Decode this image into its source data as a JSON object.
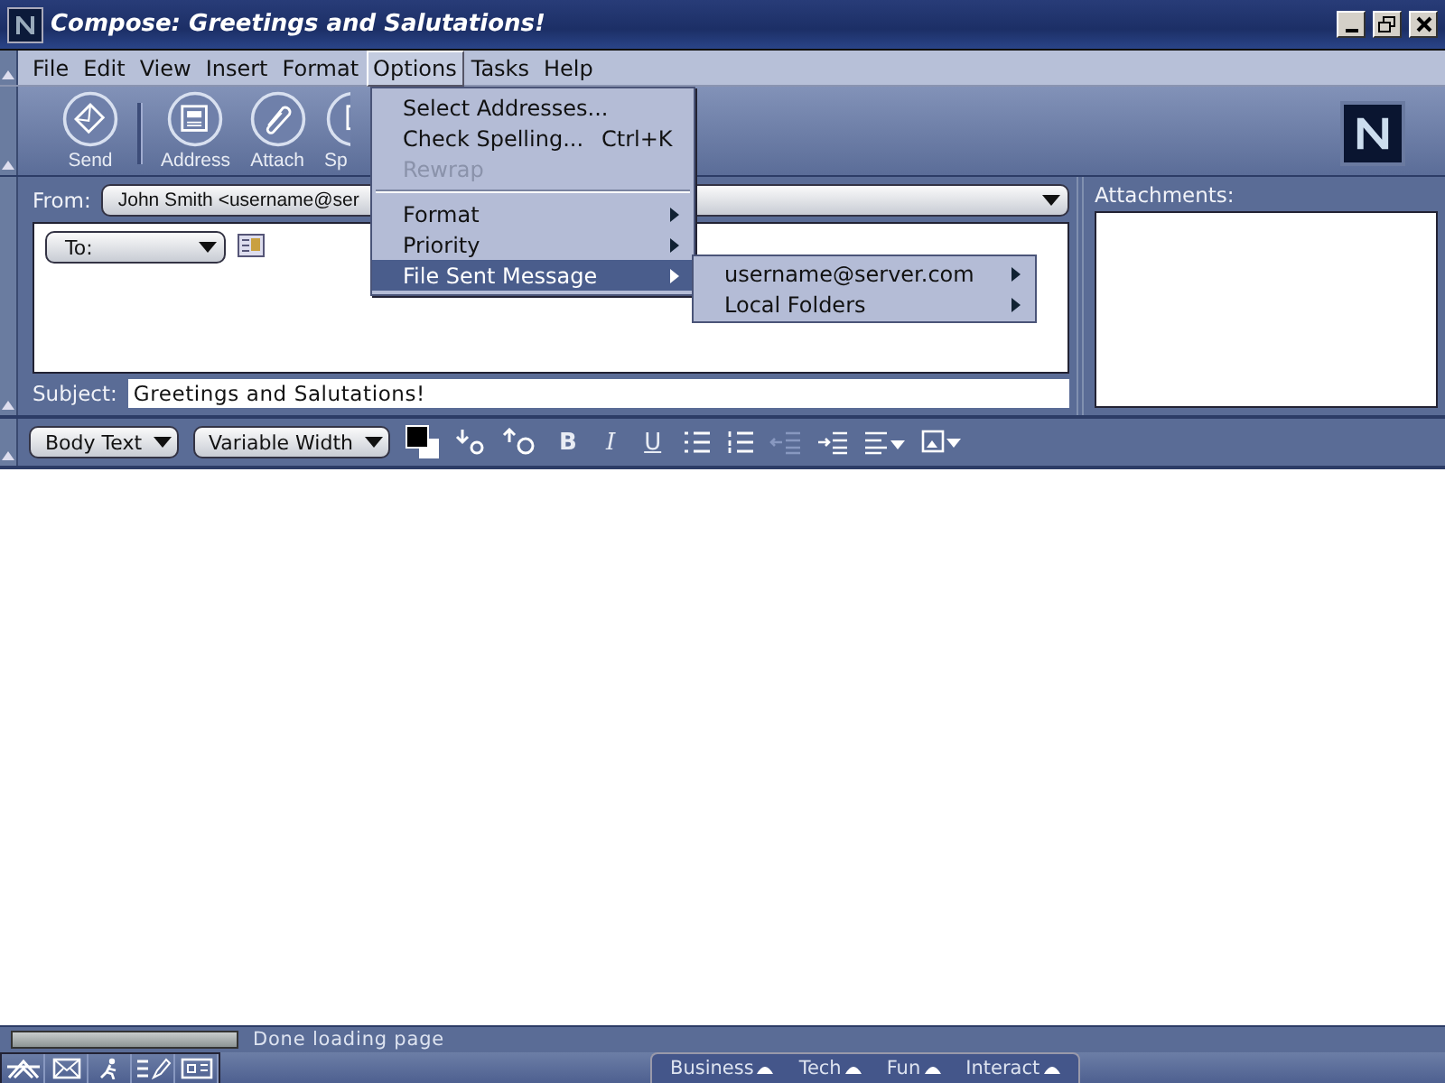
{
  "window": {
    "title": "Compose: Greetings and Salutations!"
  },
  "menubar": [
    {
      "label": "File",
      "selected": false
    },
    {
      "label": "Edit",
      "selected": false
    },
    {
      "label": "View",
      "selected": false
    },
    {
      "label": "Insert",
      "selected": false
    },
    {
      "label": "Format",
      "selected": false
    },
    {
      "label": "Options",
      "selected": true
    },
    {
      "label": "Tasks",
      "selected": false
    },
    {
      "label": "Help",
      "selected": false
    }
  ],
  "toolbar": {
    "buttons": [
      {
        "label": "Send",
        "kind": "send"
      },
      {
        "label": "Address",
        "kind": "address"
      },
      {
        "label": "Attach",
        "kind": "attach"
      },
      {
        "label": "Sp",
        "kind": "spell"
      }
    ]
  },
  "options_menu": {
    "items": [
      {
        "kind": "item",
        "label": "Select Addresses...",
        "disabled": false,
        "selected": false
      },
      {
        "kind": "item",
        "label": "Check Spelling...",
        "shortcut": "Ctrl+K",
        "disabled": false,
        "selected": false
      },
      {
        "kind": "item",
        "label": "Rewrap",
        "disabled": true,
        "selected": false
      },
      {
        "kind": "separator"
      },
      {
        "kind": "submenu",
        "label": "Format",
        "disabled": false,
        "selected": false
      },
      {
        "kind": "submenu",
        "label": "Priority",
        "disabled": false,
        "selected": false
      },
      {
        "kind": "submenu",
        "label": "File Sent Message",
        "disabled": false,
        "selected": true
      }
    ]
  },
  "submenu": {
    "items": [
      {
        "kind": "submenu",
        "label": "username@server.com",
        "selected": false
      },
      {
        "kind": "submenu",
        "label": "Local Folders",
        "selected": false
      }
    ]
  },
  "compose": {
    "from_label": "From:",
    "from_value": "John Smith <username@ser",
    "to_label": "To:",
    "subject_label": "Subject:",
    "subject_value": "Greetings and Salutations!",
    "attachments_label": "Attachments:"
  },
  "format_toolbar": {
    "paragraph_style": "Body Text",
    "font": "Variable Width",
    "style_buttons": [
      {
        "label": "B",
        "kind": "bold"
      },
      {
        "label": "I",
        "kind": "italic"
      },
      {
        "label": "U",
        "kind": "underline"
      }
    ]
  },
  "status_bar": {
    "text": "Done loading page",
    "progress": {
      "level": 0
    }
  },
  "bottom_tabs": [
    {
      "label": "Business"
    },
    {
      "label": "Tech"
    },
    {
      "label": "Fun"
    },
    {
      "label": "Interact"
    }
  ]
}
